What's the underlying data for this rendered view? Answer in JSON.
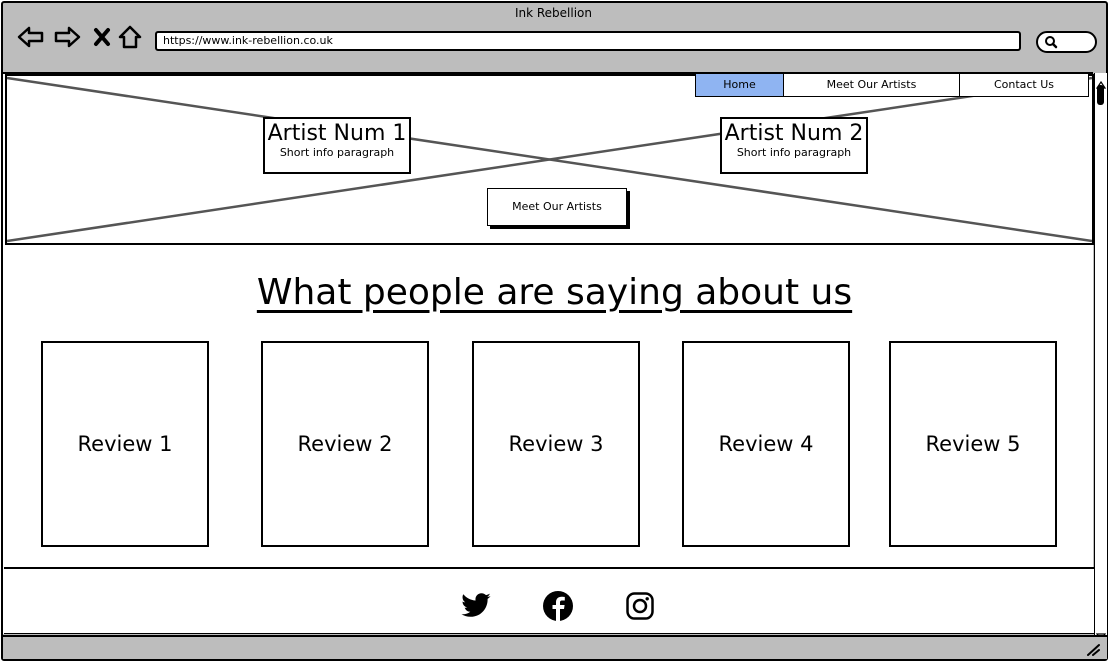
{
  "window": {
    "title": "Ink Rebellion"
  },
  "browser": {
    "url": "https://www.ink-rebellion.co.uk",
    "icons": [
      "back-arrow-icon",
      "forward-arrow-icon",
      "close-icon",
      "home-icon",
      "search-icon"
    ]
  },
  "nav": {
    "items": [
      {
        "label": "Home",
        "active": true
      },
      {
        "label": "Meet Our Artists",
        "active": false
      },
      {
        "label": "Contact Us",
        "active": false
      }
    ],
    "active_color": "#8fb4f2"
  },
  "hero": {
    "artists": [
      {
        "name": "Artist Num 1",
        "info": "Short info paragraph"
      },
      {
        "name": "Artist Num 2",
        "info": "Short info paragraph"
      }
    ],
    "button_label": "Meet Our Artists"
  },
  "reviews": {
    "heading": "What people are saying about us",
    "items": [
      "Review 1",
      "Review 2",
      "Review 3",
      "Review 4",
      "Review 5"
    ]
  },
  "footer": {
    "social_icons": [
      "twitter-icon",
      "facebook-icon",
      "instagram-icon"
    ]
  },
  "colors": {
    "chrome": "#bdbdbd",
    "placeholder_lines": "#555555"
  }
}
